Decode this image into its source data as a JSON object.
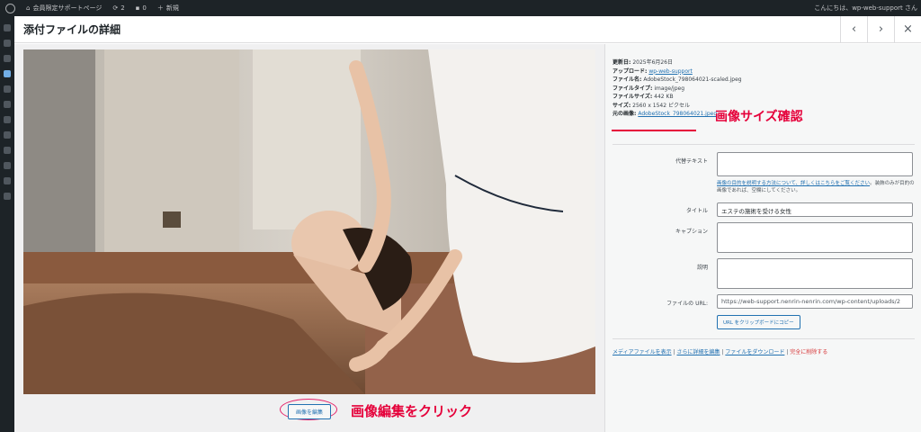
{
  "adminbar": {
    "site_name": "会員限定サポートページ",
    "updates": "2",
    "comments": "0",
    "new_label": "新規",
    "greeting": "こんにちは、wp-web-support さん"
  },
  "modal": {
    "title": "添付ファイルの詳細",
    "prev_glyph": "‹",
    "next_glyph": "›",
    "close_glyph": "×"
  },
  "image": {
    "edit_button": "画像を編集",
    "annotation": "画像編集をクリック"
  },
  "details": {
    "meta": {
      "uploaded_label": "更新日:",
      "uploaded_value": "2025年6月26日",
      "uploader_label": "アップロード:",
      "uploader_value": "wp-web-support",
      "filename_label": "ファイル名:",
      "filename_value": "AdobeStock_798064021-scaled.jpeg",
      "filetype_label": "ファイルタイプ:",
      "filetype_value": "image/jpeg",
      "filesize_label": "ファイルサイズ:",
      "filesize_value": "442 KB",
      "dimensions_label": "サイズ:",
      "dimensions_value": "2560 x 1542 ピクセル",
      "original_label": "元の画像:",
      "original_value": "AdobeStock_798064021.jpeg"
    },
    "size_annotation": "画像サイズ確認",
    "alt_label": "代替テキスト",
    "alt_value": "",
    "alt_help_link": "画像の目的を説明する方法について、詳しくはこちらをご覧ください",
    "alt_help_rest": "。装飾のみが目的の画像であれば、空欄にしてください。",
    "title_label": "タイトル",
    "title_value": "エステの施術を受ける女性",
    "caption_label": "キャプション",
    "caption_value": "",
    "description_label": "説明",
    "description_value": "",
    "url_label": "ファイルの URL:",
    "url_value": "https://web-support.nenrin-nenrin.com/wp-content/uploads/2",
    "copy_button": "URL をクリップボードにコピー",
    "actions": {
      "view": "メディアファイルを表示",
      "edit_more": "さらに詳細を編集",
      "download": "ファイルをダウンロード",
      "delete": "完全に削除する",
      "sep": "|"
    }
  },
  "colors": {
    "accent": "#2271b1",
    "annotation": "#e5003a",
    "admin_bar": "#1d2327"
  }
}
